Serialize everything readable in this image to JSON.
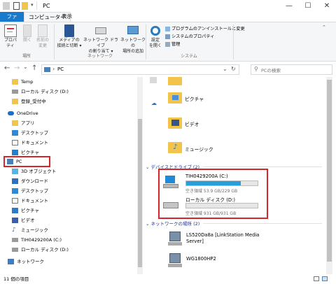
{
  "window": {
    "title": "PC",
    "minimize": "—",
    "maximize": "☐",
    "close": "✕"
  },
  "ribbon": {
    "tabs": [
      "ファイル",
      "コンピューター",
      "表示"
    ],
    "location": {
      "group_label": "場所",
      "properties": "プロパティ",
      "open": "開く",
      "rename_1": "名前の",
      "rename_2": "変更"
    },
    "network": {
      "group_label": "ネットワーク",
      "media_1": "メディアの",
      "media_2": "接続と切断 ▾",
      "map_1": "ネットワーク ドライブ",
      "map_2": "の割り当て ▾",
      "add_1": "ネットワークの",
      "add_2": "場所の追加"
    },
    "system": {
      "group_label": "システム",
      "settings_1": "設定",
      "settings_2": "を開く",
      "uninstall": "プログラムのアンインストールと変更",
      "sys_props": "システムのプロパティ",
      "manage": "管理"
    }
  },
  "address": {
    "back": "←",
    "forward": "→",
    "recent": "⌄",
    "up": "↑",
    "path_sep": "›",
    "path": "PC",
    "dropdown": "⌄",
    "refresh": "↻",
    "search_placeholder": "PCの検索"
  },
  "nav_items": [
    "Temp",
    "ローカル ディスク (D:)",
    "登録_受付中",
    "OneDrive",
    "アプリ",
    "デスクトップ",
    "ドキュメント",
    "ピクチャ",
    "PC",
    "3D オブジェクト",
    "ダウンロード",
    "デスクトップ",
    "ドキュメント",
    "ピクチャ",
    "ビデオ",
    "ミュージック",
    "TIH0429200A (C:)",
    "ローカル ディスク (D:)",
    "ネットワーク"
  ],
  "content": {
    "folders": [
      "ピクチャ",
      "ビデオ",
      "ミュージック"
    ],
    "devices_header": "デバイスとドライブ (2)",
    "drives": [
      {
        "name": "TIH0429200A (C:)",
        "free": "空き領域 53.9 GB/229 GB",
        "used_fraction": 0.76
      },
      {
        "name": "ローカル ディスク (D:)",
        "free": "空き領域 931 GB/931 GB",
        "used_fraction": 0.0
      }
    ],
    "network_header": "ネットワークの場所 (2)",
    "network_items": [
      "LS520Da8a [LinkStation Media Server]",
      "WG1800HP2"
    ]
  },
  "status": {
    "count": "11 個の項目"
  },
  "colors": {
    "accent": "#1979ca",
    "selection_box": "#d3272c",
    "drive_fill": "#26a0da",
    "header_text": "#1e3287"
  }
}
